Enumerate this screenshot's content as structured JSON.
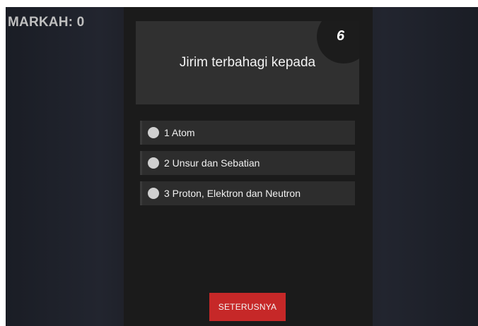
{
  "score": {
    "text": "MARKAH: 0"
  },
  "question": {
    "number": "6",
    "text": "Jirim terbahagi kepada"
  },
  "options": [
    {
      "label": "1 Atom",
      "selected": false
    },
    {
      "label": "2 Unsur dan Sebatian",
      "selected": false
    },
    {
      "label": "3 Proton, Elektron dan Neutron",
      "selected": false
    }
  ],
  "next_button": {
    "label": "SETERUSNYA"
  },
  "colors": {
    "background": "#1f2129",
    "panel": "#1b1b1b",
    "card": "#303030",
    "option": "#2d2d2d",
    "button": "#c62828"
  }
}
